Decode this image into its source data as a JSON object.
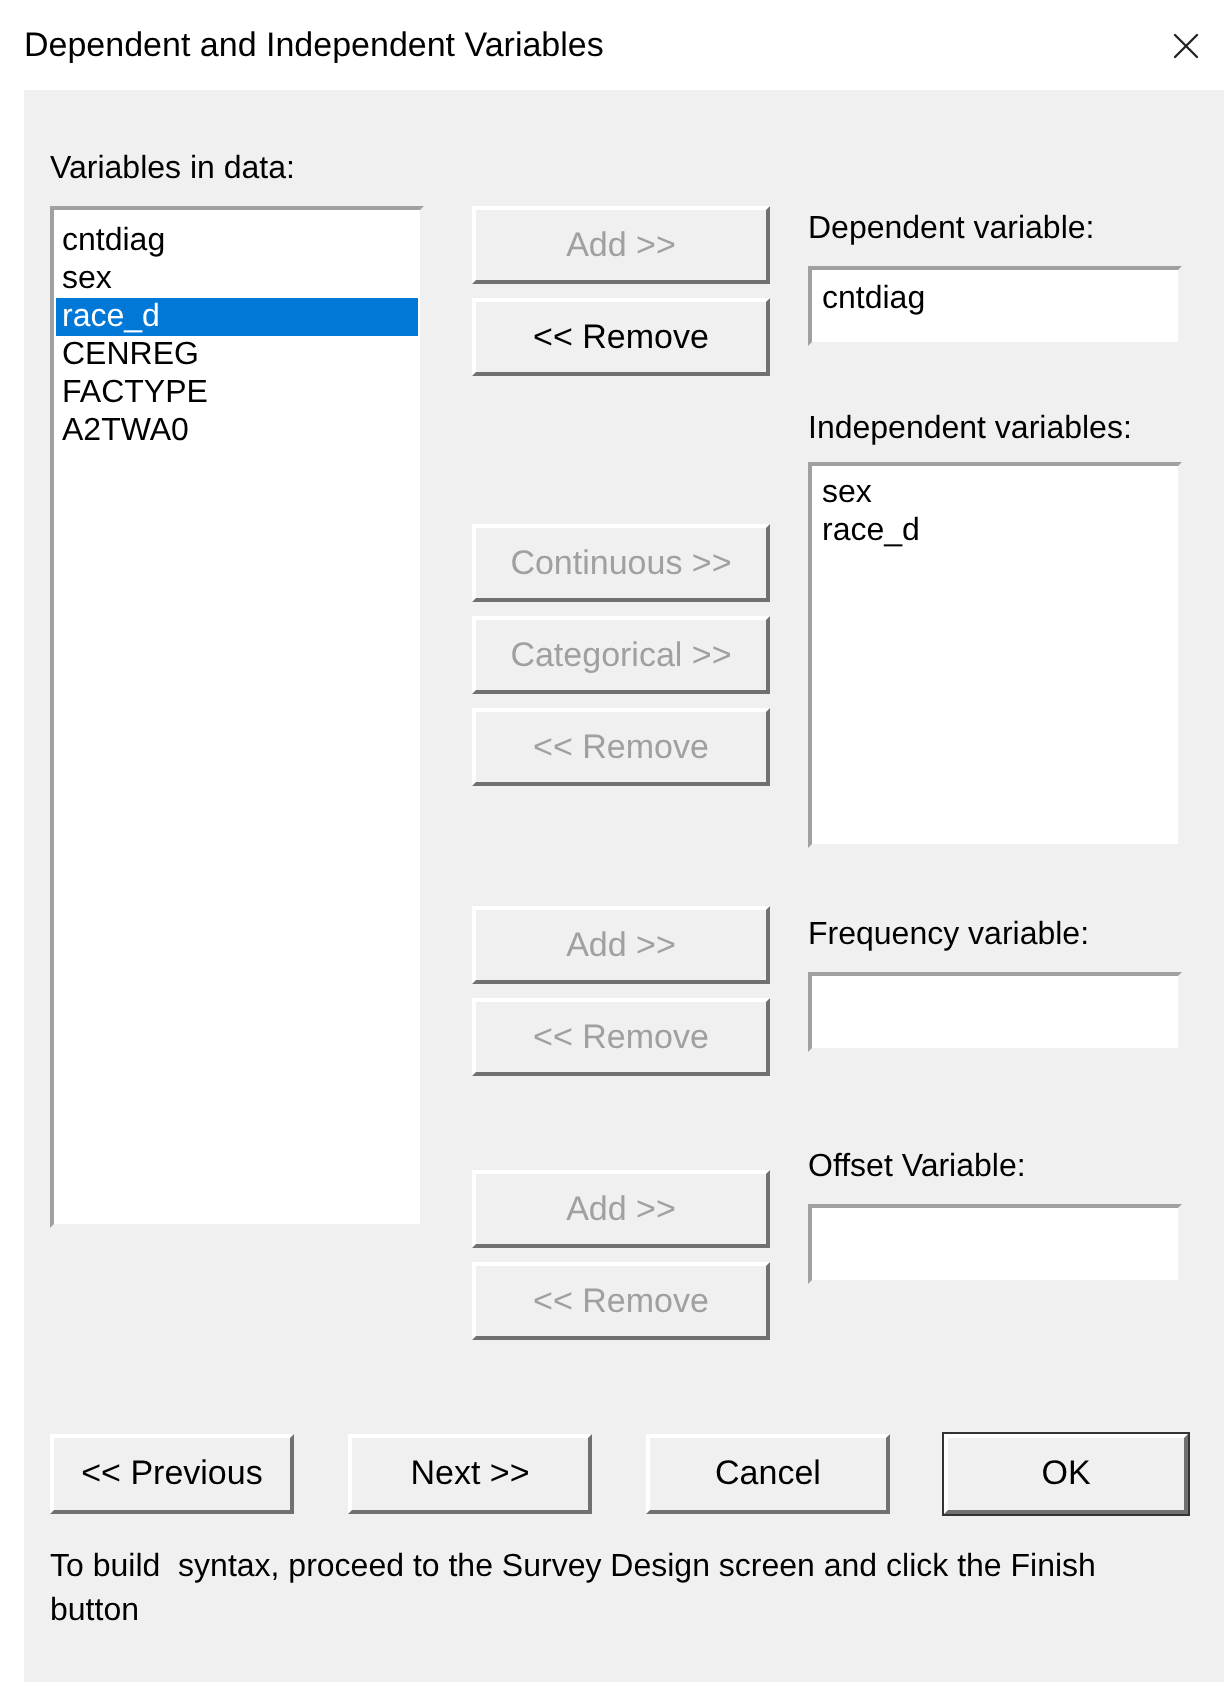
{
  "window": {
    "title": "Dependent and Independent Variables"
  },
  "variables": {
    "label": "Variables in data:",
    "items": [
      {
        "text": "cntdiag",
        "selected": false
      },
      {
        "text": "sex",
        "selected": false
      },
      {
        "text": "race_d",
        "selected": true
      },
      {
        "text": "CENREG",
        "selected": false
      },
      {
        "text": "FACTYPE",
        "selected": false
      },
      {
        "text": "A2TWA0",
        "selected": false
      }
    ]
  },
  "groups": [
    {
      "kind": "field",
      "label": "Dependent variable:",
      "value": "cntdiag",
      "buttons": [
        {
          "label": "Add >>",
          "disabled": true
        },
        {
          "label": "<< Remove",
          "disabled": false
        }
      ]
    },
    {
      "kind": "list",
      "label": "Independent variables:",
      "items": [
        "sex",
        "race_d"
      ],
      "buttons": [
        {
          "label": "Continuous >>",
          "disabled": true
        },
        {
          "label": "Categorical >>",
          "disabled": true
        },
        {
          "label": "<< Remove",
          "disabled": true
        }
      ]
    },
    {
      "kind": "field",
      "label": "Frequency variable:",
      "buttons": [
        {
          "label": "Add >>",
          "disabled": true
        },
        {
          "label": "<< Remove",
          "disabled": true
        }
      ]
    },
    {
      "kind": "field",
      "label": "Offset Variable:",
      "buttons": [
        {
          "label": "Add >>",
          "disabled": true
        },
        {
          "label": "<< Remove",
          "disabled": true
        }
      ]
    }
  ],
  "footer_buttons": [
    {
      "label": "<< Previous",
      "default": false
    },
    {
      "label": "Next >>",
      "default": false
    },
    {
      "label": "Cancel",
      "default": false
    },
    {
      "label": "OK",
      "default": true
    }
  ],
  "note": "To build  syntax, proceed to the Survey Design screen and click the Finish button"
}
